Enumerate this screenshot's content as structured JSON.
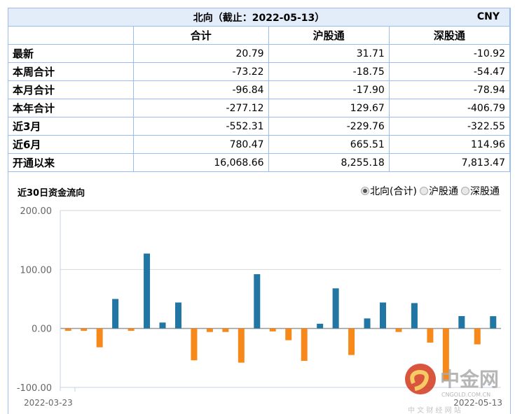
{
  "header": {
    "title": "北向（截止：2022-05-13）",
    "currency": "CNY"
  },
  "columns": [
    "合计",
    "沪股通",
    "深股通"
  ],
  "rows": [
    {
      "label": "最新",
      "values": [
        "20.79",
        "31.71",
        "-10.92"
      ]
    },
    {
      "label": "本周合计",
      "values": [
        "-73.22",
        "-18.75",
        "-54.47"
      ]
    },
    {
      "label": "本月合计",
      "values": [
        "-96.84",
        "-17.90",
        "-78.94"
      ]
    },
    {
      "label": "本年合计",
      "values": [
        "-277.12",
        "129.67",
        "-406.79"
      ]
    },
    {
      "label": "近3月",
      "values": [
        "-552.31",
        "-229.76",
        "-322.55"
      ]
    },
    {
      "label": "近6月",
      "values": [
        "780.47",
        "665.51",
        "114.96"
      ]
    },
    {
      "label": "开通以来",
      "values": [
        "16,068.66",
        "8,255.18",
        "7,813.47"
      ]
    }
  ],
  "chart_section": {
    "title": "近30日资金流向",
    "radios": [
      {
        "label": "北向(合计)",
        "selected": true
      },
      {
        "label": "沪股通",
        "selected": false
      },
      {
        "label": "深股通",
        "selected": false
      }
    ]
  },
  "watermark": {
    "brand": "中金网",
    "domain": "CNGOLD.COM.CN",
    "sub": "中 文 财 经 网 站"
  },
  "chart_data": {
    "type": "bar",
    "title": "近30日资金流向",
    "ylim": [
      -100,
      200
    ],
    "yticks": [
      "200.00",
      "100.00",
      "0.00",
      "-100.00"
    ],
    "ytick_values": [
      200,
      100,
      0,
      -100
    ],
    "xlabels": [
      "2022-03-23",
      "2022-05-13"
    ],
    "values": [
      -4,
      -4,
      -32,
      50,
      -4,
      127,
      10,
      44,
      -54,
      -6,
      -6,
      -58,
      92,
      -5,
      -20,
      -55,
      8,
      68,
      -45,
      17,
      44,
      -6,
      43,
      -24,
      -89,
      21,
      -27,
      20.79
    ],
    "colors": {
      "positive": "#2176a3",
      "negative": "#f7891b"
    }
  }
}
